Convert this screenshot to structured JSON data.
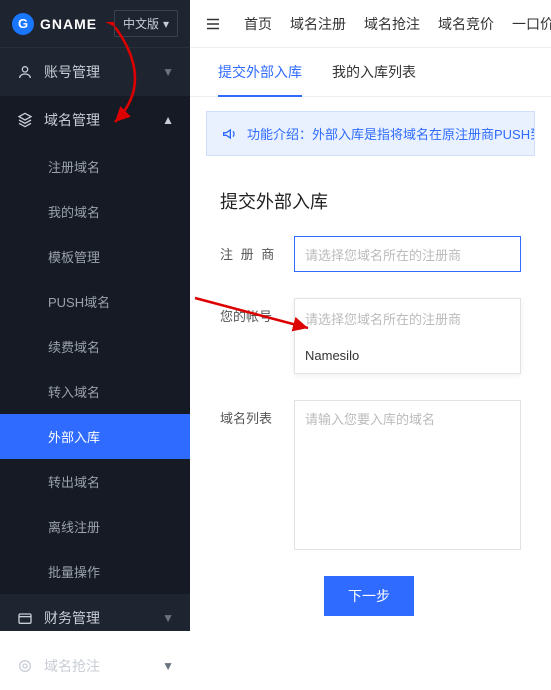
{
  "logo": {
    "mark": "G",
    "text": "GNAME"
  },
  "lang": {
    "label": "中文版"
  },
  "sidebar": {
    "categories": [
      {
        "label": "账号管理",
        "icon": "user"
      },
      {
        "label": "域名管理",
        "icon": "stack"
      },
      {
        "label": "财务管理",
        "icon": "wallet"
      },
      {
        "label": "域名抢注",
        "icon": "target"
      }
    ],
    "domain_items": [
      "注册域名",
      "我的域名",
      "模板管理",
      "PUSH域名",
      "续费域名",
      "转入域名",
      "外部入库",
      "转出域名",
      "离线注册",
      "批量操作"
    ]
  },
  "topnav": [
    "首页",
    "域名注册",
    "域名抢注",
    "域名竞价",
    "一口价"
  ],
  "tabs": [
    "提交外部入库",
    "我的入库列表"
  ],
  "notice": "功能介绍：外部入库是指将域名在原注册商PUSH到本站对",
  "form": {
    "title": "提交外部入库",
    "registrar_label": "注 册 商",
    "registrar_placeholder": "请选择您域名所在的注册商",
    "account_label": "您的帐号",
    "dropdown_placeholder": "请选择您域名所在的注册商",
    "dropdown_option": "Namesilo",
    "list_label": "域名列表",
    "list_placeholder": "请输入您要入库的域名",
    "submit": "下一步"
  }
}
